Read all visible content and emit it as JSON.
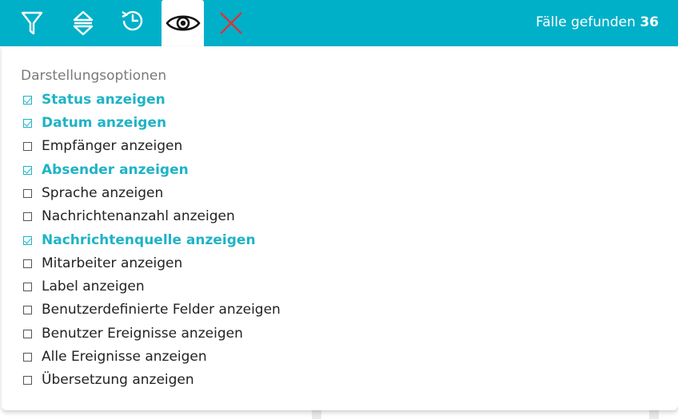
{
  "toolbar": {
    "tools": [
      {
        "icon": "filter-icon"
      },
      {
        "icon": "sort-icon"
      },
      {
        "icon": "history-icon"
      },
      {
        "icon": "eye-icon",
        "active": true
      },
      {
        "icon": "close-icon"
      }
    ],
    "count_label": "Fälle gefunden",
    "count_value": "36",
    "accent_color": "#00b0c8",
    "close_color": "#d8343b"
  },
  "panel": {
    "title": "Darstellungsoptionen",
    "options": [
      {
        "label": "Status anzeigen",
        "checked": true
      },
      {
        "label": "Datum anzeigen",
        "checked": true
      },
      {
        "label": "Empfänger anzeigen",
        "checked": false
      },
      {
        "label": "Absender anzeigen",
        "checked": true
      },
      {
        "label": "Sprache anzeigen",
        "checked": false
      },
      {
        "label": "Nachrichtenanzahl anzeigen",
        "checked": false
      },
      {
        "label": "Nachrichtenquelle anzeigen",
        "checked": true
      },
      {
        "label": "Mitarbeiter anzeigen",
        "checked": false
      },
      {
        "label": "Label anzeigen",
        "checked": false
      },
      {
        "label": "Benutzerdefinierte Felder anzeigen",
        "checked": false
      },
      {
        "label": "Benutzer Ereignisse anzeigen",
        "checked": false
      },
      {
        "label": "Alle Ereignisse anzeigen",
        "checked": false
      },
      {
        "label": "Übersetzung anzeigen",
        "checked": false
      }
    ]
  }
}
